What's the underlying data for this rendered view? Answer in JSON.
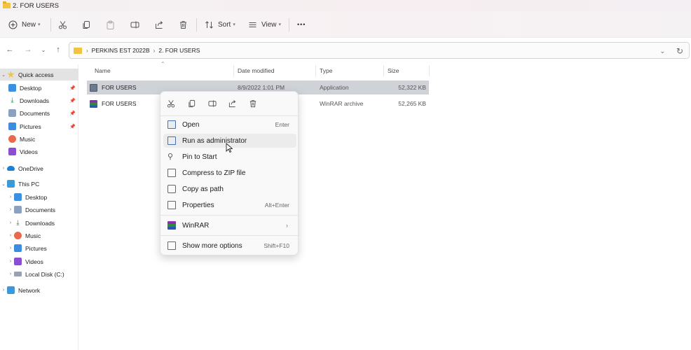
{
  "window": {
    "title": "2. FOR USERS"
  },
  "toolbar": {
    "new_label": "New",
    "sort_label": "Sort",
    "view_label": "View",
    "more_label": "•••"
  },
  "address": {
    "crumbs": [
      "PERKINS EST 2022B",
      "2. FOR USERS"
    ]
  },
  "nav": {
    "quick_access": "Quick access",
    "qa_items": [
      "Desktop",
      "Downloads",
      "Documents",
      "Pictures",
      "Music",
      "Videos"
    ],
    "onedrive": "OneDrive",
    "this_pc": "This PC",
    "pc_items": [
      "Desktop",
      "Documents",
      "Downloads",
      "Music",
      "Pictures",
      "Videos",
      "Local Disk (C:)"
    ],
    "network": "Network"
  },
  "columns": {
    "name": "Name",
    "date": "Date modified",
    "type": "Type",
    "size": "Size"
  },
  "files": [
    {
      "name": "FOR USERS",
      "date": "8/9/2022 1:01 PM",
      "type": "Application",
      "size": "52,322 KB"
    },
    {
      "name": "FOR USERS",
      "date": "",
      "type": "WinRAR archive",
      "size": "52,265 KB"
    }
  ],
  "context_menu": {
    "items": [
      {
        "label": "Open",
        "shortcut": "Enter"
      },
      {
        "label": "Run as administrator",
        "shortcut": ""
      },
      {
        "label": "Pin to Start",
        "shortcut": ""
      },
      {
        "label": "Compress to ZIP file",
        "shortcut": ""
      },
      {
        "label": "Copy as path",
        "shortcut": ""
      },
      {
        "label": "Properties",
        "shortcut": "Alt+Enter"
      },
      {
        "label": "WinRAR",
        "shortcut": ""
      },
      {
        "label": "Show more options",
        "shortcut": "Shift+F10"
      }
    ]
  },
  "colors": {
    "folder": "#f2c240",
    "selection": "#cfd3d8",
    "accent": "#2b78d4"
  }
}
